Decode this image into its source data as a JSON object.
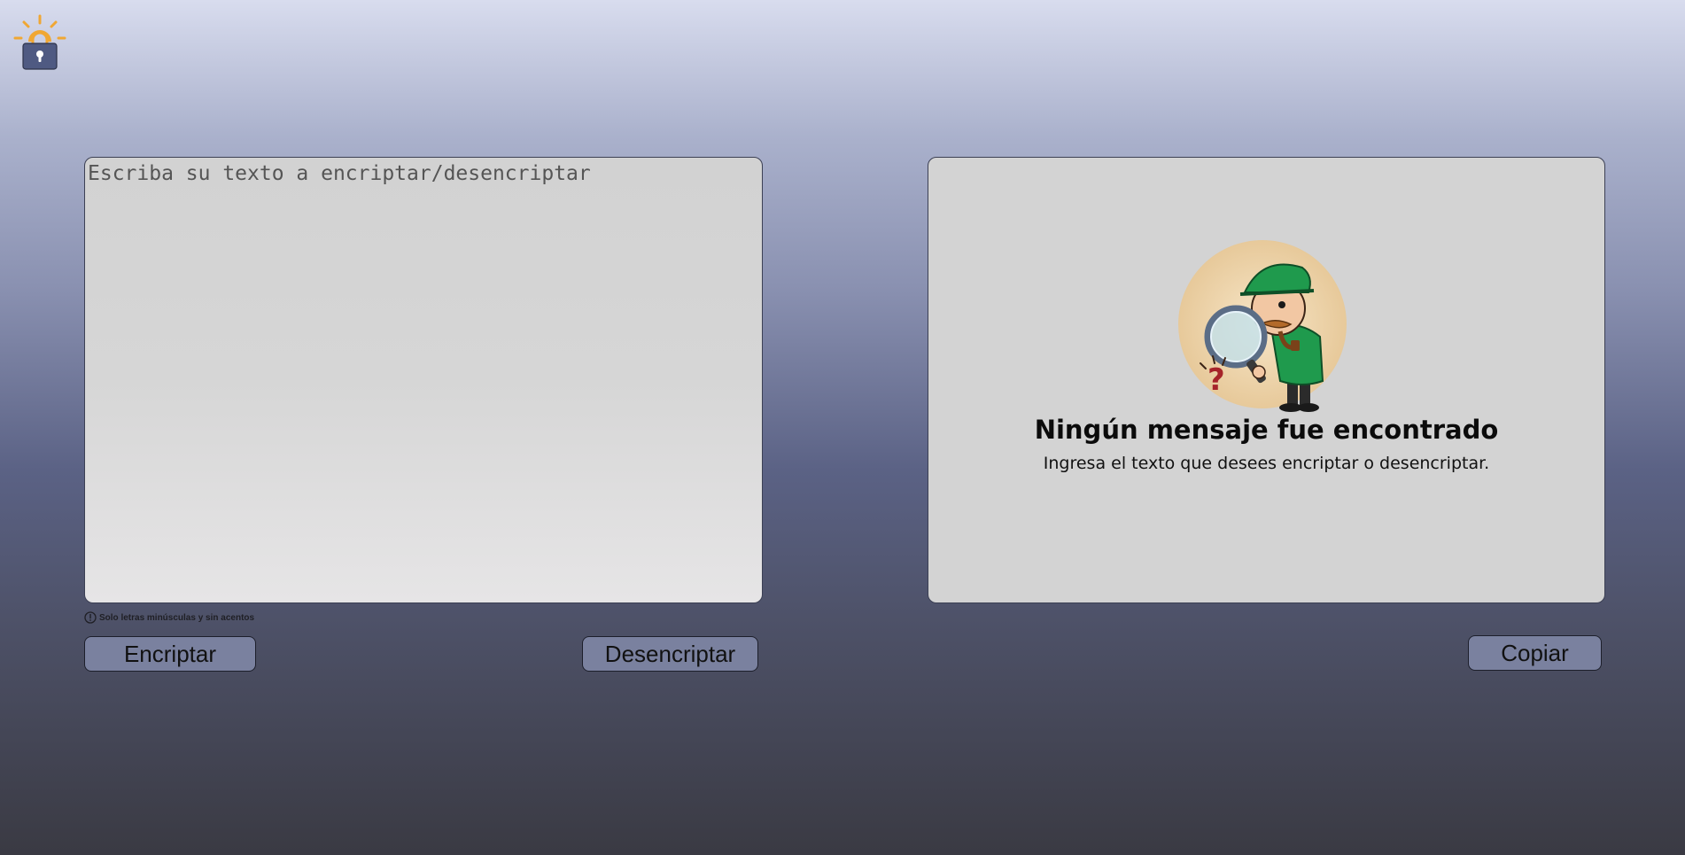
{
  "header": {
    "logo_icon": "sun-lock-icon"
  },
  "input": {
    "placeholder": "Escriba su texto a encriptar/desencriptar",
    "value": ""
  },
  "hint": {
    "icon": "info-icon",
    "text": "Solo letras minúsculas y sin acentos"
  },
  "buttons": {
    "encrypt": "Encriptar",
    "decrypt": "Desencriptar",
    "copy": "Copiar"
  },
  "output": {
    "illustration": "detective-magnifier-icon",
    "title": "Ningún mensaje fue encontrado",
    "subtitle": "Ingresa el texto que desees encriptar o desencriptar."
  },
  "colors": {
    "button_bg": "#7a819f",
    "panel_bg": "#d3d3d3",
    "logo_accent": "#f0a733",
    "logo_lock": "#4f5a82"
  }
}
